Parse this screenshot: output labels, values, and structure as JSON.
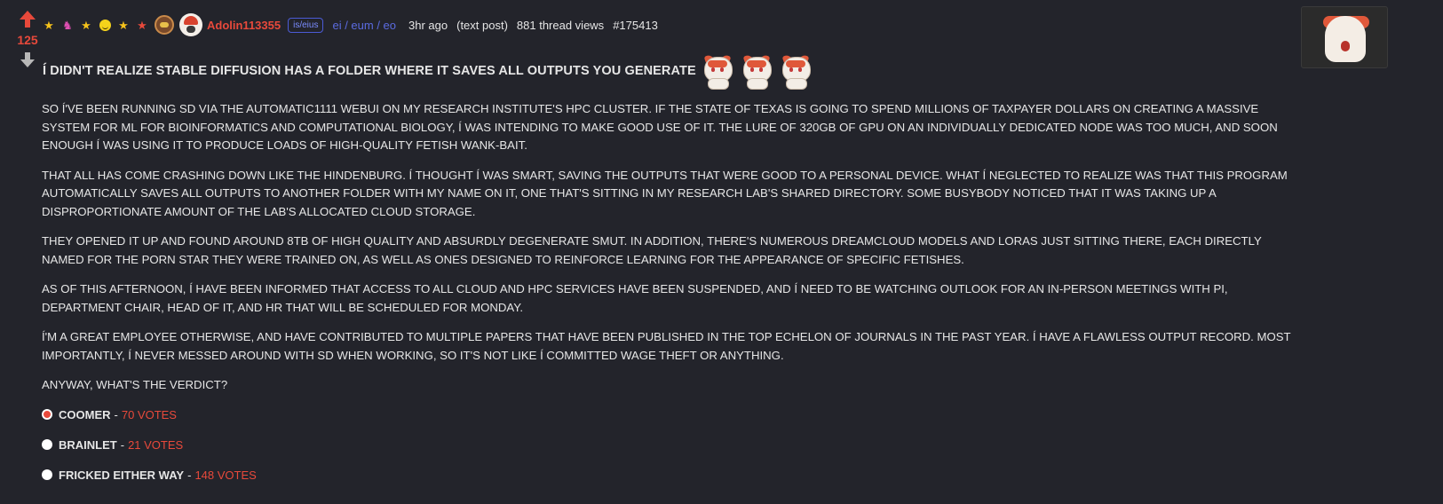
{
  "vote": {
    "score": "125"
  },
  "meta": {
    "username": "Adolin113355",
    "sub_tag": "is/eius",
    "path": "ei / eum / eo",
    "time": "3hr ago",
    "post_type": "(text post)",
    "views": "881 thread views",
    "post_id": "#175413"
  },
  "post": {
    "title": "Í DIDN'T REALIZE STABLE DIFFUSION HAS A FOLDER WHERE IT SAVES ALL OUTPUTS YOU GENERATE",
    "paragraphs": [
      "SO Í'VE BEEN RUNNING SD VIA THE AUTOMATIC1111 WEBUI ON MY RESEARCH INSTITUTE'S HPC CLUSTER. IF THE STATE OF TEXAS IS GOING TO SPEND MILLIONS OF TAXPAYER DOLLARS ON CREATING A MASSIVE SYSTEM FOR ML FOR BIOINFORMATICS AND COMPUTATIONAL BIOLOGY, Í WAS INTENDING TO MAKE GOOD USE OF IT. THE LURE OF 320GB OF GPU ON AN INDIVIDUALLY DEDICATED NODE WAS TOO MUCH, AND SOON ENOUGH Í WAS USING IT TO PRODUCE LOADS OF HIGH-QUALITY FETISH WANK-BAIT.",
      "THAT ALL HAS COME CRASHING DOWN LIKE THE HINDENBURG. Í THOUGHT Í WAS SMART, SAVING THE OUTPUTS THAT WERE GOOD TO A PERSONAL DEVICE. WHAT Í NEGLECTED TO REALIZE WAS THAT THIS PROGRAM AUTOMATICALLY SAVES ALL OUTPUTS TO ANOTHER FOLDER WITH MY NAME ON IT, ONE THAT'S SITTING IN MY RESEARCH LAB'S SHARED DIRECTORY. SOME BUSYBODY NOTICED THAT IT WAS TAKING UP A DISPROPORTIONATE AMOUNT OF THE LAB'S ALLOCATED CLOUD STORAGE.",
      "THEY OPENED IT UP AND FOUND AROUND 8TB OF HIGH QUALITY AND ABSURDLY DEGENERATE SMUT. IN ADDITION, THERE'S NUMEROUS DREAMCLOUD MODELS AND LORAS JUST SITTING THERE, EACH DIRECTLY NAMED FOR THE PORN STAR THEY WERE TRAINED ON, AS WELL AS ONES DESIGNED TO REINFORCE LEARNING FOR THE APPEARANCE OF SPECIFIC FETISHES.",
      "AS OF THIS AFTERNOON, Í HAVE BEEN INFORMED THAT ACCESS TO ALL CLOUD AND HPC SERVICES HAVE BEEN SUSPENDED, AND Í NEED TO BE WATCHING OUTLOOK FOR AN IN-PERSON MEETINGS WITH PI, DEPARTMENT CHAIR, HEAD OF IT, AND HR THAT WILL BE SCHEDULED FOR MONDAY.",
      "Í'M A GREAT EMPLOYEE OTHERWISE, AND HAVE CONTRIBUTED TO MULTIPLE PAPERS THAT HAVE BEEN PUBLISHED IN THE TOP ECHELON OF JOURNALS IN THE PAST YEAR. Í HAVE A FLAWLESS OUTPUT RECORD. MOST IMPORTANTLY, Í NEVER MESSED AROUND WITH SD WHEN WORKING, SO IT'S NOT LIKE Í COMMITTED WAGE THEFT OR ANYTHING.",
      "ANYWAY, WHAT'S THE VERDICT?"
    ]
  },
  "poll": {
    "separator": "-",
    "options": [
      {
        "label": "COOMER",
        "votes": "70 VOTES"
      },
      {
        "label": "BRAINLET",
        "votes": "21 VOTES"
      },
      {
        "label": "FRICKED EITHER WAY",
        "votes": "148 VOTES"
      }
    ]
  },
  "icons": {
    "upvote": "arrow-up-icon",
    "downvote": "arrow-down-icon",
    "flairs": [
      "star-icon",
      "horse-icon",
      "star-icon",
      "smiley-icon",
      "star-icon",
      "star-icon"
    ],
    "emotes": [
      "cat-emote-icon",
      "cat-emote-icon",
      "cat-emote-icon"
    ]
  },
  "colors": {
    "background": "#23242b",
    "accent": "#e8493b",
    "link": "#5b6be0",
    "text": "#e6e6e6"
  }
}
